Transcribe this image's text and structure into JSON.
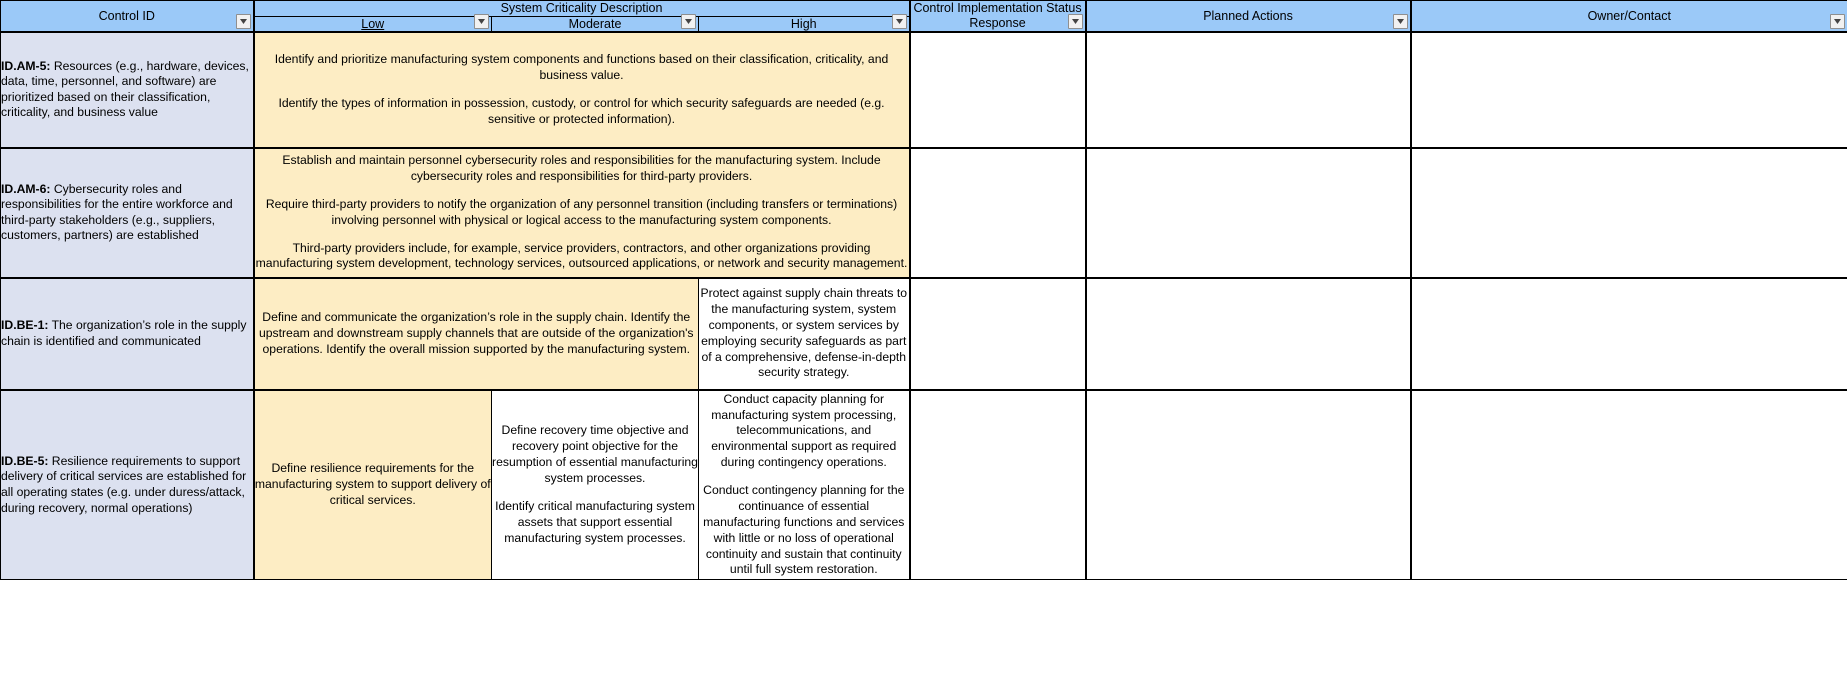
{
  "colors": {
    "header_bg": "#9BC9F8",
    "control_id_bg": "#DCE1F0",
    "description_fill": "#FDEDC4",
    "blank_fill": "#FFFFFF",
    "grid_line": "#000000"
  },
  "header": {
    "control_id": "Control ID",
    "system_criticality_description": "System Criticality Description",
    "levels": [
      {
        "label": "Low",
        "underlined": true
      },
      {
        "label": "Moderate",
        "underlined": false
      },
      {
        "label": "High",
        "underlined": false
      }
    ],
    "control_implementation_status_response": "Control Implementation Status Response",
    "planned_actions": "Planned Actions",
    "owner_contact": "Owner/Contact",
    "filter_icon": "chevron-down-icon"
  },
  "rows": [
    {
      "control_id_prefix": "ID.AM-5:",
      "control_id_text": " Resources (e.g., hardware, devices, data, time, personnel, and software) are prioritized based on their classification, criticality, and business value",
      "description_span": "all",
      "description_paragraphs": [
        "Identify and prioritize manufacturing system components and functions based on their classification, criticality, and business value.",
        "Identify the types of information in possession, custody, or control for which security safeguards are needed (e.g. sensitive or protected information)."
      ],
      "status_response": "",
      "planned_actions": "",
      "owner_contact": ""
    },
    {
      "control_id_prefix": "ID.AM-6:",
      "control_id_text": " Cybersecurity roles and responsibilities for the entire workforce and third-party stakeholders (e.g., suppliers, customers, partners) are established",
      "description_span": "all",
      "description_paragraphs": [
        "Establish and maintain personnel cybersecurity roles and responsibilities for the manufacturing system. Include cybersecurity roles and responsibilities for third-party providers.",
        "Require third-party providers to notify the organization of any personnel transition (including transfers or terminations) involving personnel with physical or logical access to the manufacturing system components.",
        "Third-party providers include, for example, service providers, contractors, and other organizations providing manufacturing system development, technology services, outsourced applications, or network and security management."
      ],
      "status_response": "",
      "planned_actions": "",
      "owner_contact": ""
    },
    {
      "control_id_prefix": "ID.BE-1:",
      "control_id_text": " The organization’s role in the supply chain is identified and communicated",
      "description_span": "low-moderate",
      "low_moderate_paragraphs": [
        "Define and communicate the organization’s role in the supply chain. Identify the upstream and downstream supply channels that are outside of the organization's operations. Identify the overall mission supported by the manufacturing system."
      ],
      "high_paragraphs": [
        "Protect against supply chain threats to the manufacturing system, system components, or system services by employing security safeguards as part of a comprehensive, defense-in-depth security strategy."
      ],
      "status_response": "",
      "planned_actions": "",
      "owner_contact": ""
    },
    {
      "control_id_prefix": "ID.BE-5:",
      "control_id_text": " Resilience requirements to support delivery of critical services are established for all operating states (e.g. under duress/attack, during recovery, normal operations)",
      "description_span": "separate",
      "low_paragraphs": [
        "Define resilience requirements for the manufacturing system to support delivery of critical services."
      ],
      "moderate_paragraphs": [
        "Define recovery time objective and recovery point objective for the resumption of essential manufacturing system processes.",
        "Identify critical manufacturing system assets that support essential manufacturing system processes."
      ],
      "high_paragraphs": [
        "Conduct capacity planning for manufacturing system processing, telecommunications, and environmental support as required during contingency operations.",
        "Conduct contingency planning for the continuance of essential manufacturing functions and services with little or no loss of operational continuity and sustain that continuity until full system restoration."
      ],
      "status_response": "",
      "planned_actions": "",
      "owner_contact": ""
    }
  ]
}
